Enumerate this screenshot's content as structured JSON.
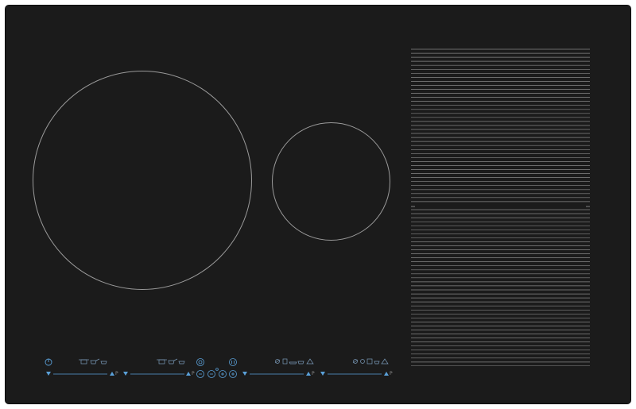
{
  "cooktop": {
    "surface_color": "#1b1b1b",
    "line_color": "#9a9a9a",
    "control_accent": "#5aa0d8"
  },
  "controls": {
    "slider_1": {
      "icon": "power-icon",
      "label": "P"
    },
    "slider_2": {
      "label": "P"
    },
    "slider_3": {
      "label": "P"
    },
    "slider_4": {
      "label": "P"
    },
    "icons": [
      "power-icon",
      "pot-icon",
      "pan-icon",
      "lock-icon",
      "pause-icon",
      "minus-icon",
      "timer-icon",
      "plus-icon",
      "pan-hob-icon"
    ]
  }
}
